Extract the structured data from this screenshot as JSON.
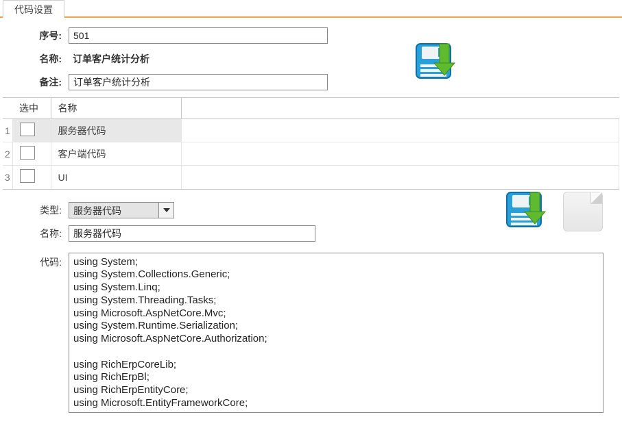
{
  "tab": {
    "label": "代码设置"
  },
  "form": {
    "seq_label": "序号:",
    "seq_value": "501",
    "name_label": "名称:",
    "name_value": "订单客户统计分析",
    "remark_label": "备注:",
    "remark_value": "订单客户统计分析"
  },
  "grid": {
    "headers": {
      "selected": "选中",
      "name": "名称"
    },
    "rows": [
      {
        "idx": "1",
        "name": "服务器代码",
        "selected": true
      },
      {
        "idx": "2",
        "name": "客户端代码",
        "selected": false
      },
      {
        "idx": "3",
        "name": "UI",
        "selected": false
      }
    ]
  },
  "lower": {
    "type_label": "类型:",
    "type_value": "服务器代码",
    "name_label": "名称:",
    "name_value": "服务器代码",
    "code_label": "代码:",
    "code_value": "using System;\nusing System.Collections.Generic;\nusing System.Linq;\nusing System.Threading.Tasks;\nusing Microsoft.AspNetCore.Mvc;\nusing System.Runtime.Serialization;\nusing Microsoft.AspNetCore.Authorization;\n\nusing RichErpCoreLib;\nusing RichErpBl;\nusing RichErpEntityCore;\nusing Microsoft.EntityFrameworkCore;"
  },
  "icons": {
    "save": "save-download-icon",
    "new": "new-blank-icon"
  }
}
